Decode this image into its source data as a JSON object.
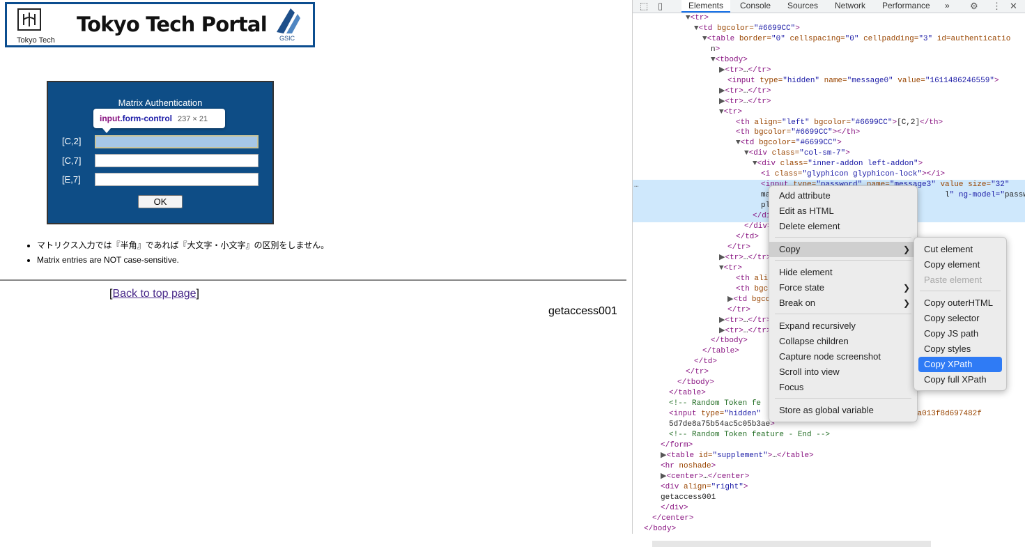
{
  "page": {
    "banner": {
      "title": "Tokyo Tech Portal",
      "logo_text": "Tokyo Tech",
      "gsic_text": "GSIC"
    },
    "auth": {
      "heading": "Matrix Authentication",
      "rows": [
        {
          "label": "[C,2]",
          "value": ""
        },
        {
          "label": "[C,7]",
          "value": ""
        },
        {
          "label": "[E,7]",
          "value": ""
        }
      ],
      "ok_label": "OK"
    },
    "tooltip": {
      "tag": "input",
      "cls": ".form-control",
      "size": "237 × 21"
    },
    "notes": [
      "マトリクス入力では『半角』であれば『大文字・小文字』の区別をしません。",
      "Matrix entries are NOT case-sensitive."
    ],
    "back": {
      "open": "[",
      "link": "Back to top page",
      "close": "]"
    },
    "getaccess": "getaccess001"
  },
  "devtools": {
    "tabs": [
      "Elements",
      "Console",
      "Sources",
      "Network",
      "Performance"
    ],
    "more": "»",
    "lines": [
      "▼<tr>",
      "▼<td bgcolor=\"#6699CC\">",
      "▼<table border=\"0\" cellspacing=\"0\" cellpadding=\"3\" id=\"authenticatio",
      "n\">",
      "▼<tbody>",
      "▶<tr>…</tr>",
      "<input type=\"hidden\" name=\"message0\" value=\"1611486246559\">",
      "▶<tr>…</tr>",
      "▶<tr>…</tr>",
      "▼<tr>",
      "<th align=\"left\" bgcolor=\"#6699CC\">[C,2]</th>",
      "<th bgcolor=\"#6699CC\"></th>",
      "▼<td bgcolor=\"#6699CC\">",
      "▼<div class=\"col-sm-7\">",
      "▼<div class=\"inner-addon left-addon\">",
      "<i class=\"glyphicon glyphicon-lock\"></i>",
      "<input type=\"password\" name=\"message3\" value size=\"32\"",
      "ma                                      l\" ng-model=\"password\"",
      "pl",
      "</di",
      "</div>",
      "</td>",
      "</tr>",
      "▶<tr>…</tr>",
      "▼<tr>",
      "<th alig",
      "<th bgco",
      "▶<td bgco",
      "</tr>",
      "▶<tr>…</tr>",
      "▶<tr>…</tr>",
      "</tbody>",
      "</table>",
      "</td>",
      "</tr>",
      "</tbody>",
      "</table>",
      "<!-- Random Token fe",
      "<input type=\"hidden\"                         0cdb7026ea013f8d697482f",
      "5d7de8a75b54ac5c05b3ae\">",
      "<!-- Random Token feature - End -->",
      "</form>",
      "▶<table id=\"supplement\">…</table>",
      "<hr noshade>",
      "▶<center>…</center>",
      "<div align=\"right\">",
      "getaccess001",
      "</div>",
      "</center>",
      "</body>"
    ],
    "dots": "…"
  },
  "context_menu": {
    "items": [
      {
        "label": "Add attribute"
      },
      {
        "label": "Edit as HTML"
      },
      {
        "label": "Delete element"
      },
      {
        "label": "Copy",
        "submenu": true
      },
      {
        "label": "Hide element"
      },
      {
        "label": "Force state",
        "submenu": true
      },
      {
        "label": "Break on",
        "submenu": true
      },
      {
        "label": "Expand recursively"
      },
      {
        "label": "Collapse children"
      },
      {
        "label": "Capture node screenshot"
      },
      {
        "label": "Scroll into view"
      },
      {
        "label": "Focus"
      },
      {
        "label": "Store as global variable"
      }
    ]
  },
  "copy_submenu": {
    "items": [
      {
        "label": "Cut element"
      },
      {
        "label": "Copy element"
      },
      {
        "label": "Paste element",
        "disabled": true
      },
      {
        "label": "Copy outerHTML"
      },
      {
        "label": "Copy selector"
      },
      {
        "label": "Copy JS path"
      },
      {
        "label": "Copy styles"
      },
      {
        "label": "Copy XPath",
        "highlighted": true
      },
      {
        "label": "Copy full XPath"
      }
    ]
  },
  "colors": {
    "panel_blue": "#0e4d86",
    "highlight": "#2f7bf5",
    "selected_row": "#cfe8fc"
  }
}
